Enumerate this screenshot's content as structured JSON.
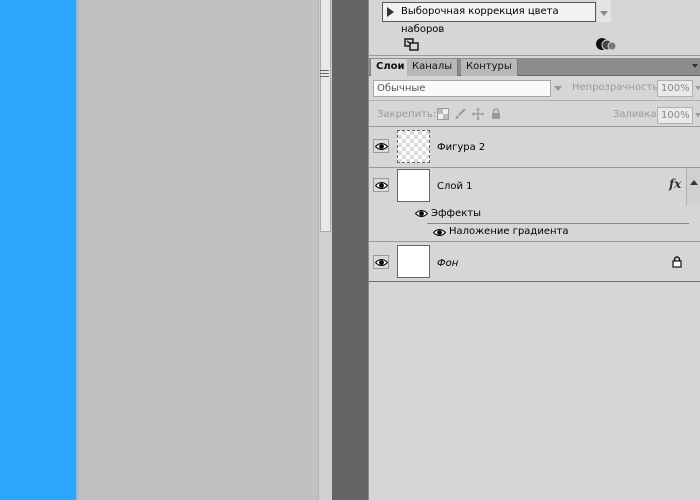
{
  "adjustments": {
    "preset_item": "Выборочная коррекция цвета наборов"
  },
  "layers_panel": {
    "tabs": [
      {
        "label": "Слои",
        "active": true
      },
      {
        "label": "Каналы",
        "active": false
      },
      {
        "label": "Контуры",
        "active": false
      }
    ],
    "blend_mode": "Обычные",
    "opacity_label": "Непрозрачность:",
    "opacity_value": "100%",
    "lock_label": "Закрепить:",
    "fill_label": "Заливка:",
    "fill_value": "100%",
    "layers": [
      {
        "name": "Фигура 2",
        "visible": true
      },
      {
        "name": "Слой 1",
        "visible": true,
        "fx": "fx"
      },
      {
        "name": "Фон",
        "visible": true,
        "locked": true
      }
    ],
    "effects_label": "Эффекты",
    "effect_item": "Наложение градиента"
  },
  "colors": {
    "canvas_blue": "#2aa6fd",
    "canvas_gray": "#c1c1c1",
    "panel_bg": "#d6d6d6",
    "splitter": "#646464"
  },
  "icons": [
    "eye-icon",
    "lock-icon",
    "fx-icon",
    "move-icon",
    "brush-icon",
    "transparency-lock-icon"
  ]
}
